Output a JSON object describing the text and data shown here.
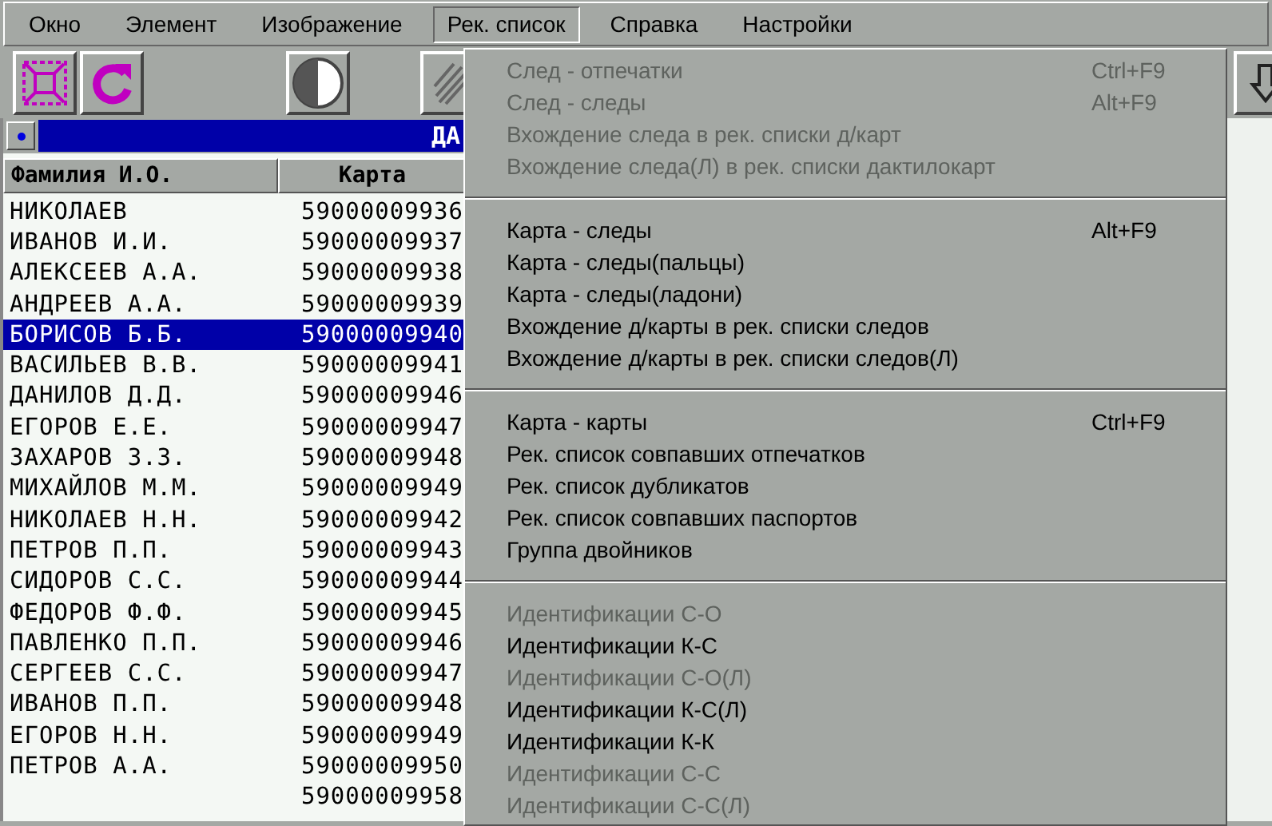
{
  "menubar": [
    {
      "label": "Окно",
      "selected": false
    },
    {
      "label": "Элемент",
      "selected": false
    },
    {
      "label": "Изображение",
      "selected": false
    },
    {
      "label": "Рек. список",
      "selected": true
    },
    {
      "label": "Справка",
      "selected": false
    },
    {
      "label": "Настройки",
      "selected": false
    }
  ],
  "toolbar": [
    {
      "kind": "fit"
    },
    {
      "kind": "rotate"
    },
    {
      "kind": "spacer"
    },
    {
      "kind": "contrast"
    },
    {
      "kind": "fingerprint"
    }
  ],
  "title_bar": {
    "text": "ДА"
  },
  "table": {
    "columns": [
      "Фамилия И.О.",
      "Карта"
    ],
    "rows": [
      {
        "name": "НИКОЛАЕВ",
        "card": "59000009936",
        "selected": false
      },
      {
        "name": "ИВАНОВ И.И.",
        "card": "59000009937",
        "selected": false
      },
      {
        "name": "АЛЕКСЕЕВ А.А.",
        "card": "59000009938",
        "selected": false
      },
      {
        "name": "АНДРЕЕВ А.А.",
        "card": "59000009939",
        "selected": false
      },
      {
        "name": "БОРИСОВ Б.Б.",
        "card": "59000009940",
        "selected": true
      },
      {
        "name": "ВАСИЛЬЕВ В.В.",
        "card": "59000009941",
        "selected": false
      },
      {
        "name": "ДАНИЛОВ Д.Д.",
        "card": "59000009946",
        "selected": false
      },
      {
        "name": "ЕГОРОВ Е.Е.",
        "card": "59000009947",
        "selected": false
      },
      {
        "name": "ЗАХАРОВ З.З.",
        "card": "59000009948",
        "selected": false
      },
      {
        "name": "МИХАЙЛОВ М.М.",
        "card": "59000009949",
        "selected": false
      },
      {
        "name": "НИКОЛАЕВ Н.Н.",
        "card": "59000009942",
        "selected": false
      },
      {
        "name": "ПЕТРОВ П.П.",
        "card": "59000009943",
        "selected": false
      },
      {
        "name": "СИДОРОВ С.С.",
        "card": "59000009944",
        "selected": false
      },
      {
        "name": "ФЕДОРОВ Ф.Ф.",
        "card": "59000009945",
        "selected": false
      },
      {
        "name": "ПАВЛЕНКО П.П.",
        "card": "59000009946",
        "selected": false
      },
      {
        "name": "СЕРГЕЕВ С.С.",
        "card": "59000009947",
        "selected": false
      },
      {
        "name": "ИВАНОВ П.П.",
        "card": "59000009948",
        "selected": false
      },
      {
        "name": "ЕГОРОВ Н.Н.",
        "card": "59000009949",
        "selected": false
      },
      {
        "name": "ПЕТРОВ А.А.",
        "card": "59000009950",
        "selected": false
      },
      {
        "card": "59000009958",
        "selected": false
      }
    ]
  },
  "dropdown": {
    "groups": [
      [
        {
          "label": "След - отпечатки",
          "shortcut": "Ctrl+F9",
          "disabled": true
        },
        {
          "label": "След - следы",
          "shortcut": "Alt+F9",
          "disabled": true
        },
        {
          "label": "Вхождение следа в рек. списки д/карт",
          "disabled": true
        },
        {
          "label": "Вхождение следа(Л) в рек. списки дактилокарт",
          "disabled": true
        }
      ],
      [
        {
          "label": "Карта - следы",
          "shortcut": "Alt+F9",
          "disabled": false
        },
        {
          "label": "Карта - следы(пальцы)",
          "disabled": false
        },
        {
          "label": "Карта - следы(ладони)",
          "disabled": false
        },
        {
          "label": "Вхождение д/карты в рек. списки следов",
          "disabled": false
        },
        {
          "label": "Вхождение д/карты в рек. списки следов(Л)",
          "disabled": false
        }
      ],
      [
        {
          "label": "Карта - карты",
          "shortcut": "Ctrl+F9",
          "disabled": false
        },
        {
          "label": "Рек. список совпавших отпечатков",
          "disabled": false
        },
        {
          "label": "Рек. список дубликатов",
          "disabled": false
        },
        {
          "label": "Рек. список совпавших паспортов",
          "disabled": false
        },
        {
          "label": "Группа двойников",
          "disabled": false
        }
      ],
      [
        {
          "label": "Идентификации С-О",
          "disabled": true
        },
        {
          "label": "Идентификации К-С",
          "disabled": false
        },
        {
          "label": "Идентификации С-О(Л)",
          "disabled": true
        },
        {
          "label": "Идентификации К-С(Л)",
          "disabled": false
        },
        {
          "label": "Идентификации К-К",
          "disabled": false
        },
        {
          "label": "Идентификации С-С",
          "disabled": true
        },
        {
          "label": "Идентификации С-С(Л)",
          "disabled": true
        }
      ]
    ]
  }
}
